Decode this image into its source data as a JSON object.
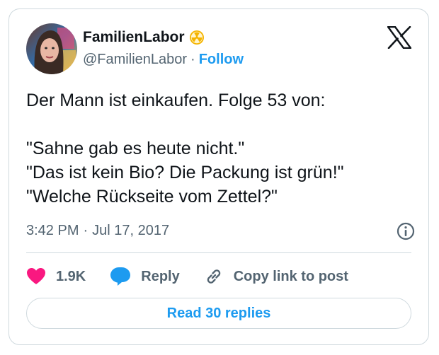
{
  "author": {
    "display_name": "FamilienLabor",
    "handle": "@FamilienLabor",
    "separator": "·",
    "follow_label": "Follow",
    "badge_icon": "radioactive-icon",
    "avatar": "avatar"
  },
  "tweet": {
    "text": "Der Mann ist einkaufen. Folge 53 von:\n\n\"Sahne gab es heute nicht.\"\n\"Das ist kein Bio? Die Packung ist grün!\"\n\"Welche Rückseite vom Zettel?\"",
    "time": "3:42 PM",
    "date": "Jul 17, 2017",
    "meta_separator": "·"
  },
  "actions": {
    "like_count": "1.9K",
    "reply_label": "Reply",
    "copy_label": "Copy link to post"
  },
  "read_replies_label": "Read 30 replies",
  "colors": {
    "accent": "#1d9bf0",
    "like": "#f91880",
    "text": "#0f1419",
    "muted": "#536471",
    "border": "#cfd9de"
  }
}
